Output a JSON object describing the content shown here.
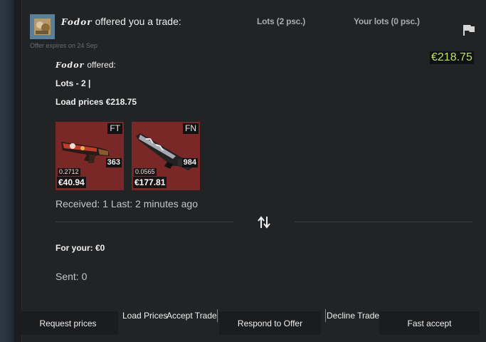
{
  "header": {
    "sender_name": "Fodor",
    "offer_text": "offered you a trade:",
    "expires": "Offer expires on 24 Sep"
  },
  "tabs": [
    {
      "label": "Lots (2 psc.)"
    },
    {
      "label": "Your lots (0 psc.)"
    }
  ],
  "total_price": "€218.75",
  "summary": {
    "offered_name": "Fodor",
    "offered_suffix": "offered:",
    "lots_line": "Lots - 2 |",
    "load_prices_line": "Load prices €218.75"
  },
  "items": [
    {
      "wear": "FT",
      "count": "363",
      "float": "0.2712",
      "price": "€40.94",
      "bg_color": "#7a2727"
    },
    {
      "wear": "FN",
      "count": "984",
      "float": "0.0565",
      "price": "€177.81",
      "bg_color": "#7a2727"
    }
  ],
  "received_text": "Received: 1 Last: 2 minutes ago",
  "for_your_text": "For your: €0",
  "sent_text": "Sent: 0",
  "buttons": {
    "request_prices": "Request prices",
    "load_prices": "Load Prices",
    "accept_trade": "Accept Trade",
    "respond_to_offer": "Respond to Offer",
    "decline_trade": "Decline Trade",
    "fast_accept": "Fast accept"
  },
  "icons": {
    "flag": "flag-icon",
    "swap": "swap-arrows-icon"
  },
  "colors": {
    "price_accent": "#bde06a",
    "item_bg": "#7a2727"
  }
}
